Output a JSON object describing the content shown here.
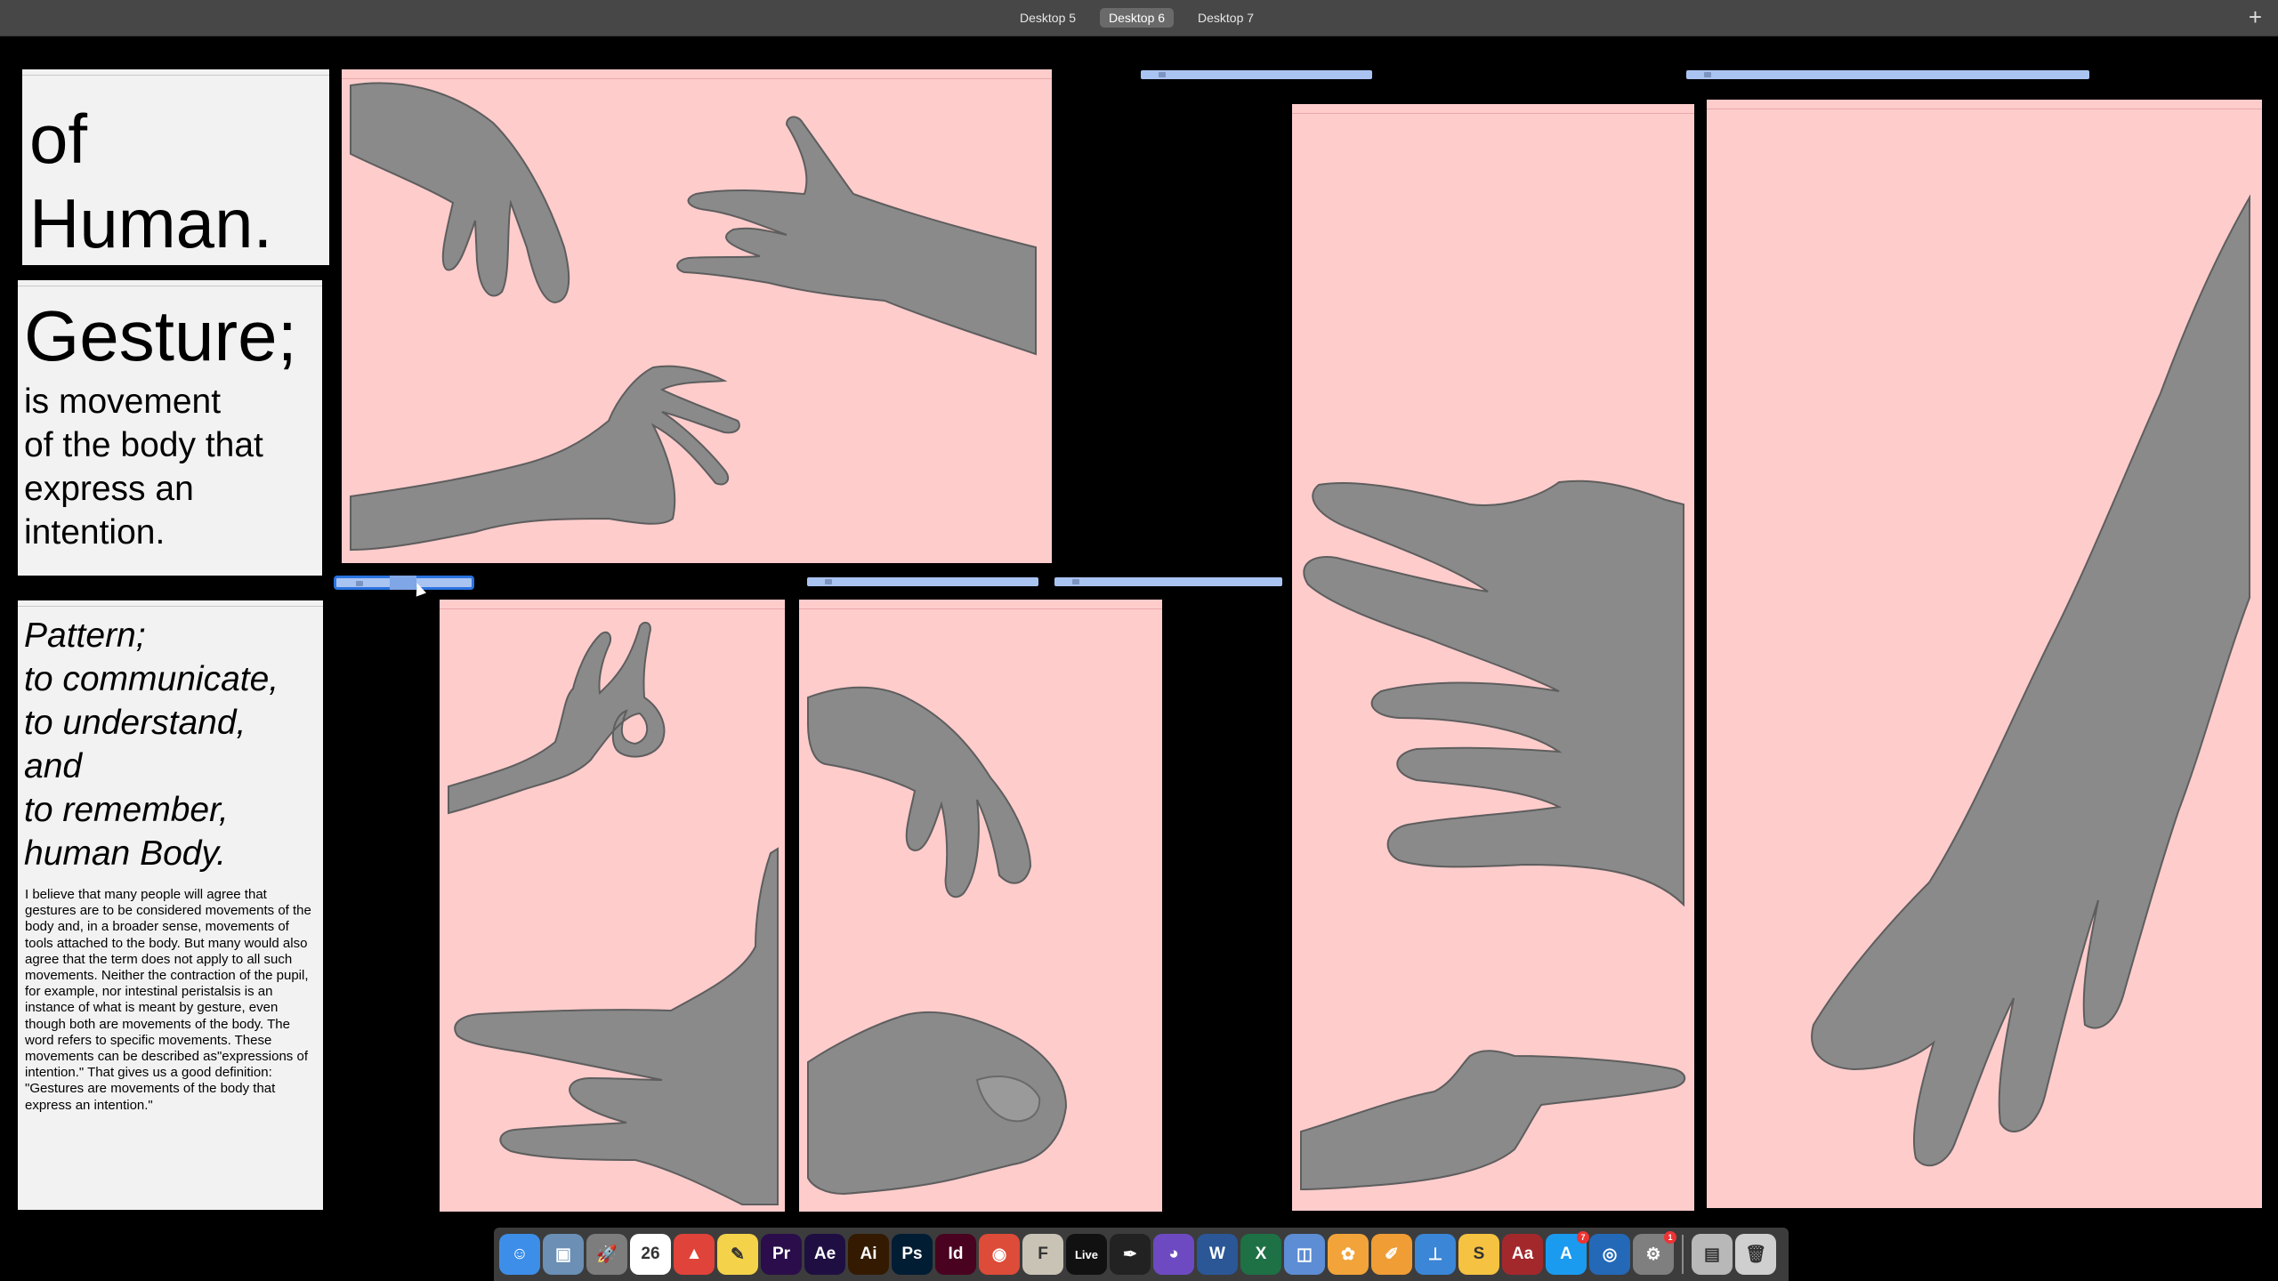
{
  "mission_control": {
    "spaces": [
      {
        "label": "Desktop 5",
        "active": false
      },
      {
        "label": "Desktop 6",
        "active": true
      },
      {
        "label": "Desktop 7",
        "active": false
      }
    ],
    "add_space_label": "+"
  },
  "windows": {
    "title_panel": {
      "line1": "of",
      "line2": "Human."
    },
    "gesture_panel": {
      "heading": "Gesture;",
      "body": "is movement\nof the body that\nexpress an\nintention."
    },
    "pattern_panel": {
      "heading": "Pattern;\nto communicate,\nto understand,\nand\nto remember,\nhuman Body.",
      "paragraph": "I believe that many people will agree that gestures are to be considered movements of the body and, in a broader sense, movements of tools attached to the body. But many would also agree that the term does not apply to all such movements. Neither the contraction of the pupil, for example, nor intestinal peristalsis is an instance of what is meant by gesture, even though both are movements of the body. The word refers to specific movements. These movements can be described as\"expressions of intention.\" That gives us a good definition: \"Gestures are movements of the body that express an intention.\""
    }
  },
  "colors": {
    "pink_background": "#ffcccc",
    "panel_background": "#f2f2f2",
    "desktop_background": "#000000",
    "selection_blue": "#aac4f2"
  },
  "dock": {
    "apps": [
      {
        "name": "finder-icon",
        "glyph": "☺",
        "color": "#3d8ee8"
      },
      {
        "name": "preview-icon",
        "glyph": "▣",
        "color": "#6b8fb5"
      },
      {
        "name": "launchpad-icon",
        "glyph": "🚀",
        "color": "#7d7d7d"
      },
      {
        "name": "calendar-icon",
        "glyph": "26",
        "color": "#ffffff"
      },
      {
        "name": "flashcards-icon",
        "glyph": "▲",
        "color": "#e0433a"
      },
      {
        "name": "notes-icon",
        "glyph": "✎",
        "color": "#f4d24a"
      },
      {
        "name": "premiere-icon",
        "glyph": "Pr",
        "color": "#2a0d4a"
      },
      {
        "name": "after-effects-icon",
        "glyph": "Ae",
        "color": "#1f0e42"
      },
      {
        "name": "illustrator-icon",
        "glyph": "Ai",
        "color": "#331a00"
      },
      {
        "name": "photoshop-icon",
        "glyph": "Ps",
        "color": "#001d34"
      },
      {
        "name": "indesign-icon",
        "glyph": "Id",
        "color": "#49021f"
      },
      {
        "name": "chrome-icon",
        "glyph": "◉",
        "color": "#dd4b39"
      },
      {
        "name": "font-book-icon",
        "glyph": "F",
        "color": "#c9c3b6"
      },
      {
        "name": "ableton-live-icon",
        "glyph": "Live",
        "color": "#111111"
      },
      {
        "name": "pen-tool-icon",
        "glyph": "✒",
        "color": "#222222"
      },
      {
        "name": "github-icon",
        "glyph": "◕",
        "color": "#6e4ac2"
      },
      {
        "name": "word-icon",
        "glyph": "W",
        "color": "#2b5797"
      },
      {
        "name": "excel-icon",
        "glyph": "X",
        "color": "#1e7145"
      },
      {
        "name": "keynote-doc-icon",
        "glyph": "◫",
        "color": "#5d8dd4"
      },
      {
        "name": "photos-icon",
        "glyph": "✿",
        "color": "#f2a43a"
      },
      {
        "name": "pages-icon",
        "glyph": "✐",
        "color": "#f09d35"
      },
      {
        "name": "keynote-icon",
        "glyph": "⊥",
        "color": "#3b86d6"
      },
      {
        "name": "sketch-icon",
        "glyph": "S",
        "color": "#f5c242"
      },
      {
        "name": "dictionary-icon",
        "glyph": "Aa",
        "color": "#a3282c"
      },
      {
        "name": "app-store-icon",
        "glyph": "A",
        "color": "#1a9bf0",
        "badge": "7"
      },
      {
        "name": "quicktime-icon",
        "glyph": "◎",
        "color": "#2469b8"
      },
      {
        "name": "system-preferences-icon",
        "glyph": "⚙",
        "color": "#7f7f7f",
        "badge": "1"
      }
    ],
    "stack_apps": [
      {
        "name": "downloads-stack-icon",
        "glyph": "▤",
        "color": "#b8b8b8"
      },
      {
        "name": "trash-icon",
        "glyph": "🗑",
        "color": "#cfcfcf"
      }
    ]
  }
}
